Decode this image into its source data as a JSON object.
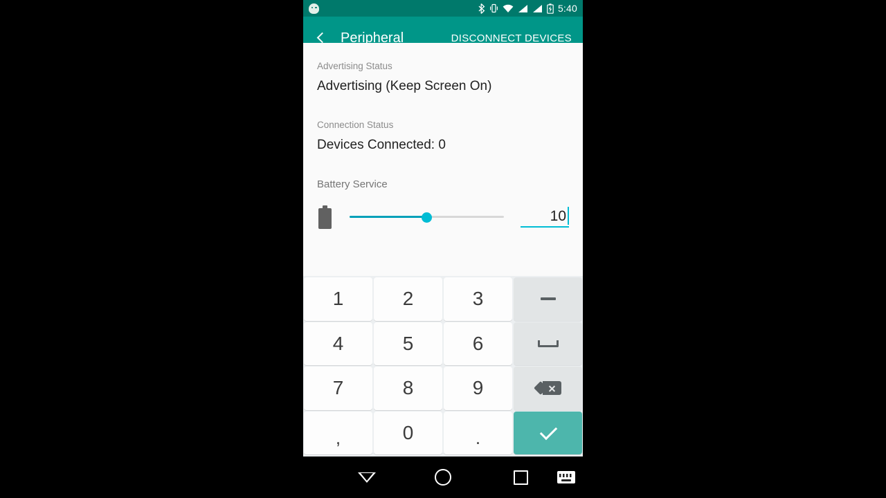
{
  "status_bar": {
    "notification_icon": "android-mascot-icon",
    "icons": [
      "bluetooth-icon",
      "vibrate-icon",
      "wifi-icon",
      "signal-icon-1",
      "signal-icon-2",
      "battery-charging-icon"
    ],
    "time": "5:40",
    "background_color": "#00796b"
  },
  "app_bar": {
    "back_label": "back-icon",
    "title": "Peripheral",
    "action_label": "DISCONNECT DEVICES",
    "background_color": "#009688"
  },
  "content": {
    "advertising": {
      "label": "Advertising Status",
      "value": "Advertising (Keep Screen On)"
    },
    "connection": {
      "label": "Connection Status",
      "value": "Devices Connected: 0"
    },
    "battery_service": {
      "section_label": "Battery Service",
      "icon": "battery-icon",
      "slider": {
        "value": 50,
        "min": 0,
        "max": 100,
        "fill_color": "#00a0b8",
        "thumb_color": "#00bcd4",
        "track_color": "#d8d8d8"
      },
      "input": {
        "value": "10",
        "accent_color": "#00bcd4",
        "focused": true
      }
    }
  },
  "keyboard": {
    "background_color": "#eceff1",
    "enter_key_color": "#4db6ac",
    "rows": [
      [
        {
          "label": "1",
          "name": "key-1",
          "type": "digit"
        },
        {
          "label": "2",
          "name": "key-2",
          "type": "digit"
        },
        {
          "label": "3",
          "name": "key-3",
          "type": "digit"
        },
        {
          "label": "",
          "name": "key-minus",
          "type": "fn",
          "glyph": "minus-icon"
        }
      ],
      [
        {
          "label": "4",
          "name": "key-4",
          "type": "digit"
        },
        {
          "label": "5",
          "name": "key-5",
          "type": "digit"
        },
        {
          "label": "6",
          "name": "key-6",
          "type": "digit"
        },
        {
          "label": "",
          "name": "key-space",
          "type": "fn",
          "glyph": "space-icon"
        }
      ],
      [
        {
          "label": "7",
          "name": "key-7",
          "type": "digit"
        },
        {
          "label": "8",
          "name": "key-8",
          "type": "digit"
        },
        {
          "label": "9",
          "name": "key-9",
          "type": "digit"
        },
        {
          "label": "",
          "name": "key-backspace",
          "type": "fn",
          "glyph": "backspace-icon"
        }
      ],
      [
        {
          "label": ",",
          "name": "key-comma",
          "type": "digit"
        },
        {
          "label": "0",
          "name": "key-0",
          "type": "digit"
        },
        {
          "label": ".",
          "name": "key-period",
          "type": "digit"
        },
        {
          "label": "",
          "name": "key-enter",
          "type": "enter",
          "glyph": "check-icon"
        }
      ]
    ]
  },
  "nav_bar": {
    "back": "triangle-down-icon",
    "home": "circle-icon",
    "recents": "square-icon",
    "switch_keyboard": "keyboard-icon"
  }
}
